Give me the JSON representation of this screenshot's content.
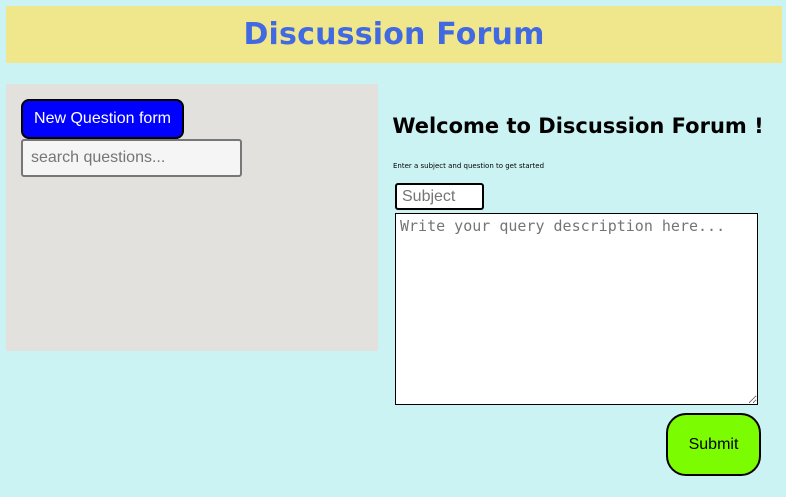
{
  "header": {
    "title": "Discussion Forum"
  },
  "left_panel": {
    "new_question_label": "New Question form",
    "search": {
      "placeholder": "search questions...",
      "value": ""
    }
  },
  "form": {
    "welcome_title": "Welcome to Discussion Forum !",
    "welcome_subtitle": "Enter a subject and question to get started",
    "subject": {
      "placeholder": "Subject",
      "value": ""
    },
    "description": {
      "placeholder": "Write your query description here...",
      "value": ""
    },
    "submit_label": "Submit"
  },
  "colors": {
    "page_background": "#ccf3f4",
    "header_background": "#f0e68c",
    "header_text": "#4169e1",
    "left_panel_background": "#e2e1dd",
    "new_question_button": "#0000ff",
    "submit_button": "#7cfc00"
  }
}
